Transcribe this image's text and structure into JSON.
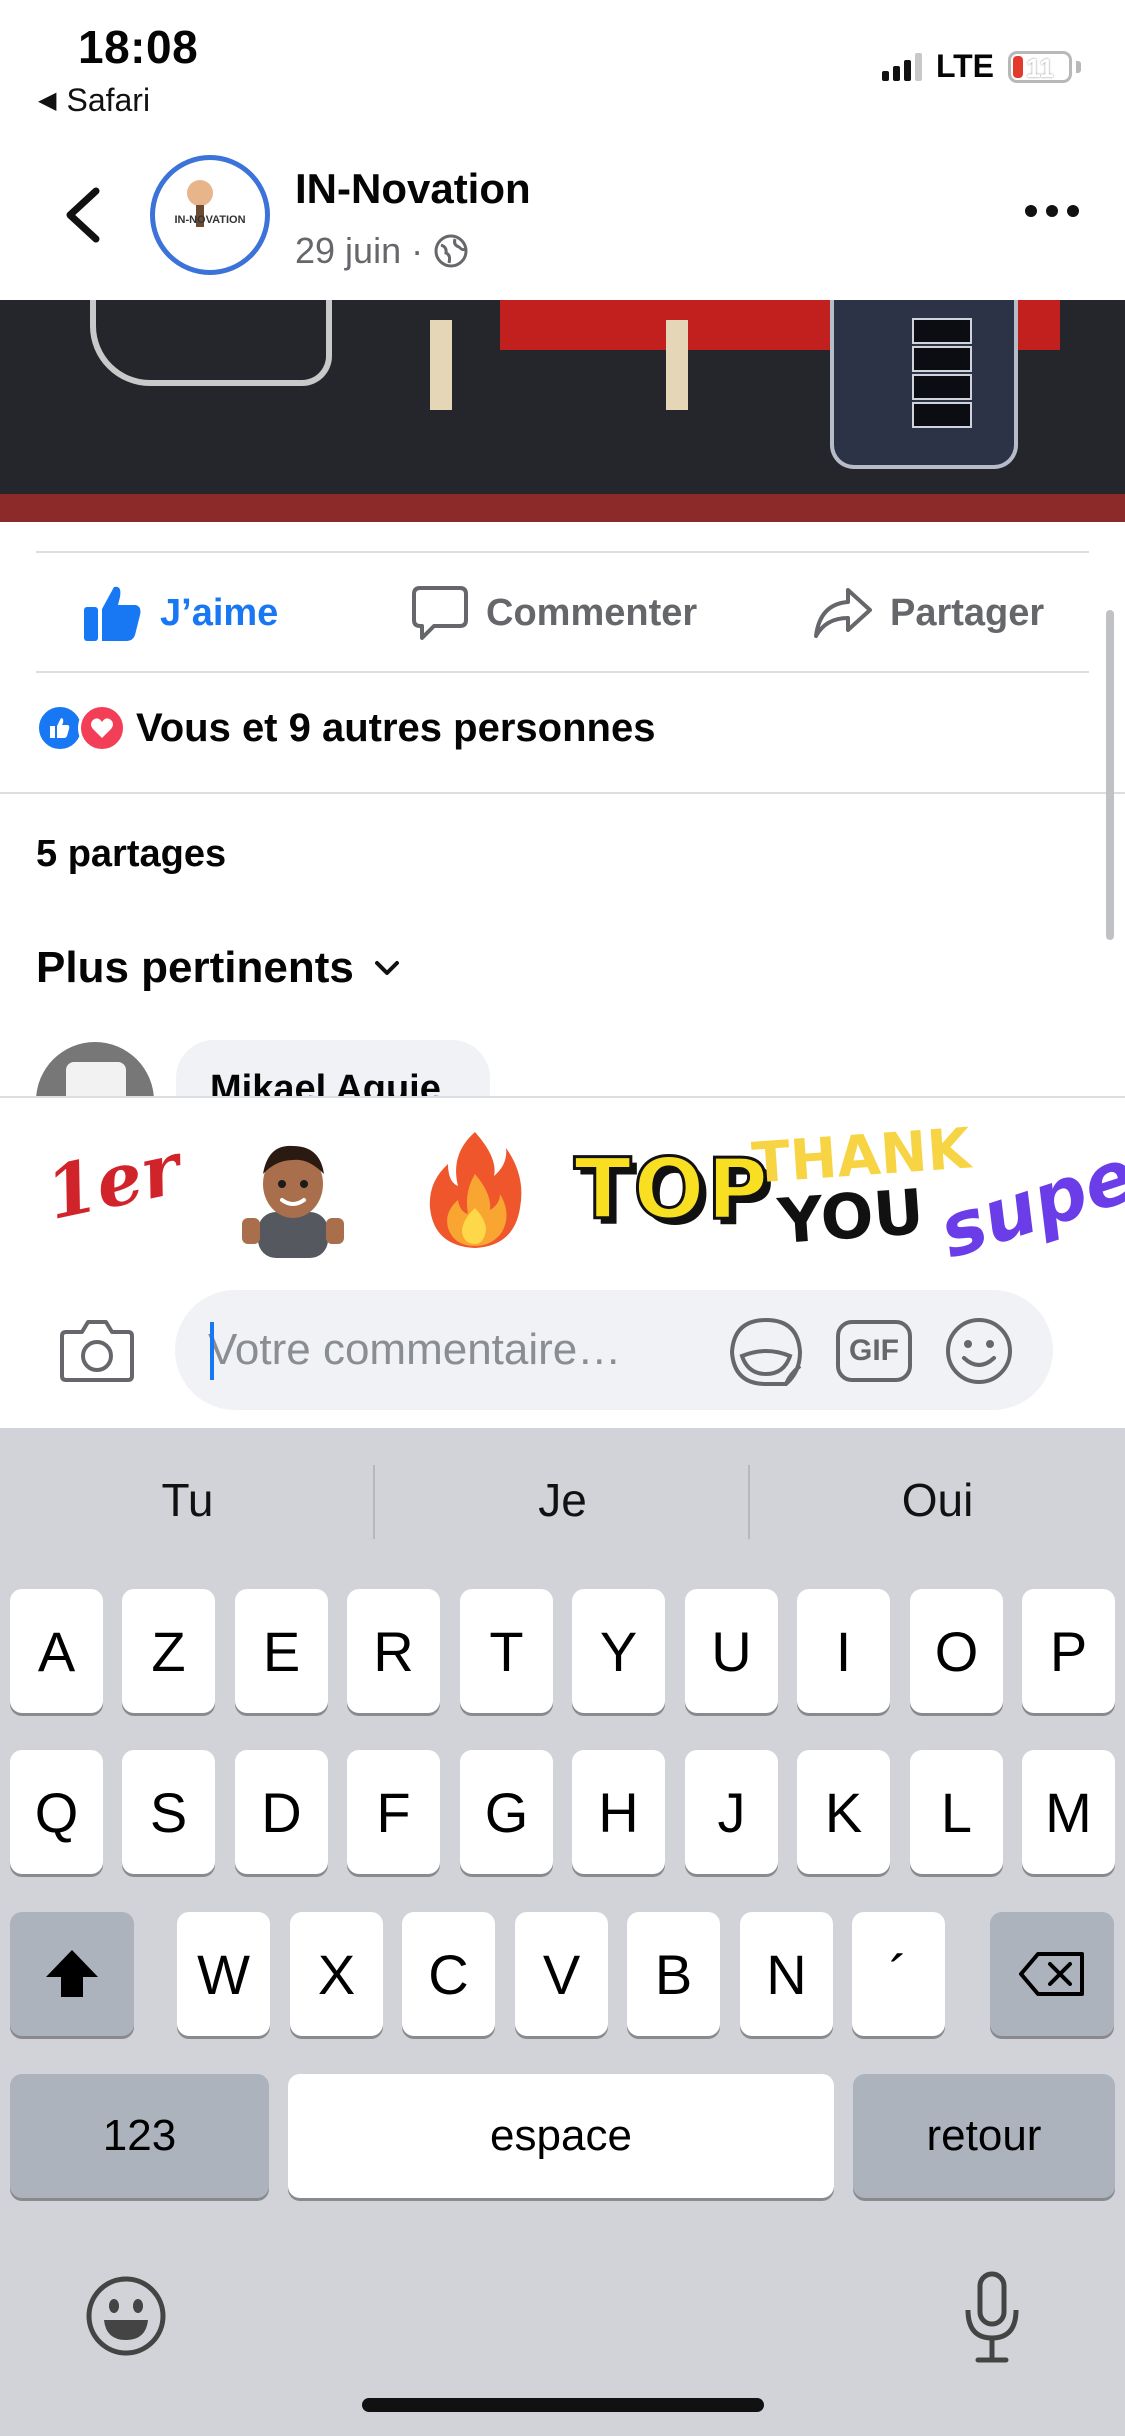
{
  "status_bar": {
    "time": "18:08",
    "back_app": "Safari",
    "network": "LTE",
    "battery": "11",
    "battery_color": "#e23b2e"
  },
  "header": {
    "page_name": "IN-Novation",
    "avatar_text": "IN-NOVATION",
    "date": "29 juin",
    "separator": "·",
    "audience_icon": "globe-icon",
    "more_icon": "more-dots-icon"
  },
  "actions": {
    "like_label": "J’aime",
    "comment_label": "Commenter",
    "share_label": "Partager",
    "like_color": "#1877f2"
  },
  "reactions": {
    "text": "Vous et 9 autres personnes",
    "icons": [
      "like-reaction-icon",
      "love-reaction-icon"
    ]
  },
  "shares": {
    "text": "5 partages"
  },
  "sort": {
    "label": "Plus pertinents"
  },
  "comment_preview": {
    "author": "Mikael Aguie"
  },
  "stickers": {
    "items": [
      {
        "name": "first-place-sticker",
        "text": "1er"
      },
      {
        "name": "memoji-thumbs-up-sticker"
      },
      {
        "name": "fire-sticker"
      },
      {
        "name": "top-sticker",
        "text": "TOP"
      },
      {
        "name": "thank-you-sticker",
        "line1": "THANK",
        "line2": "YOU"
      },
      {
        "name": "super-sticker",
        "text": "super!"
      }
    ]
  },
  "composer": {
    "placeholder": "Votre commentaire…",
    "gif_label": "GIF"
  },
  "keyboard": {
    "suggestions": [
      "Tu",
      "Je",
      "Oui"
    ],
    "row1": [
      "A",
      "Z",
      "E",
      "R",
      "T",
      "Y",
      "U",
      "I",
      "O",
      "P"
    ],
    "row2": [
      "Q",
      "S",
      "D",
      "F",
      "G",
      "H",
      "J",
      "K",
      "L",
      "M"
    ],
    "row3": [
      "W",
      "X",
      "C",
      "V",
      "B",
      "N",
      "´"
    ],
    "numbers_key": "123",
    "space_key": "espace",
    "return_key": "retour"
  }
}
